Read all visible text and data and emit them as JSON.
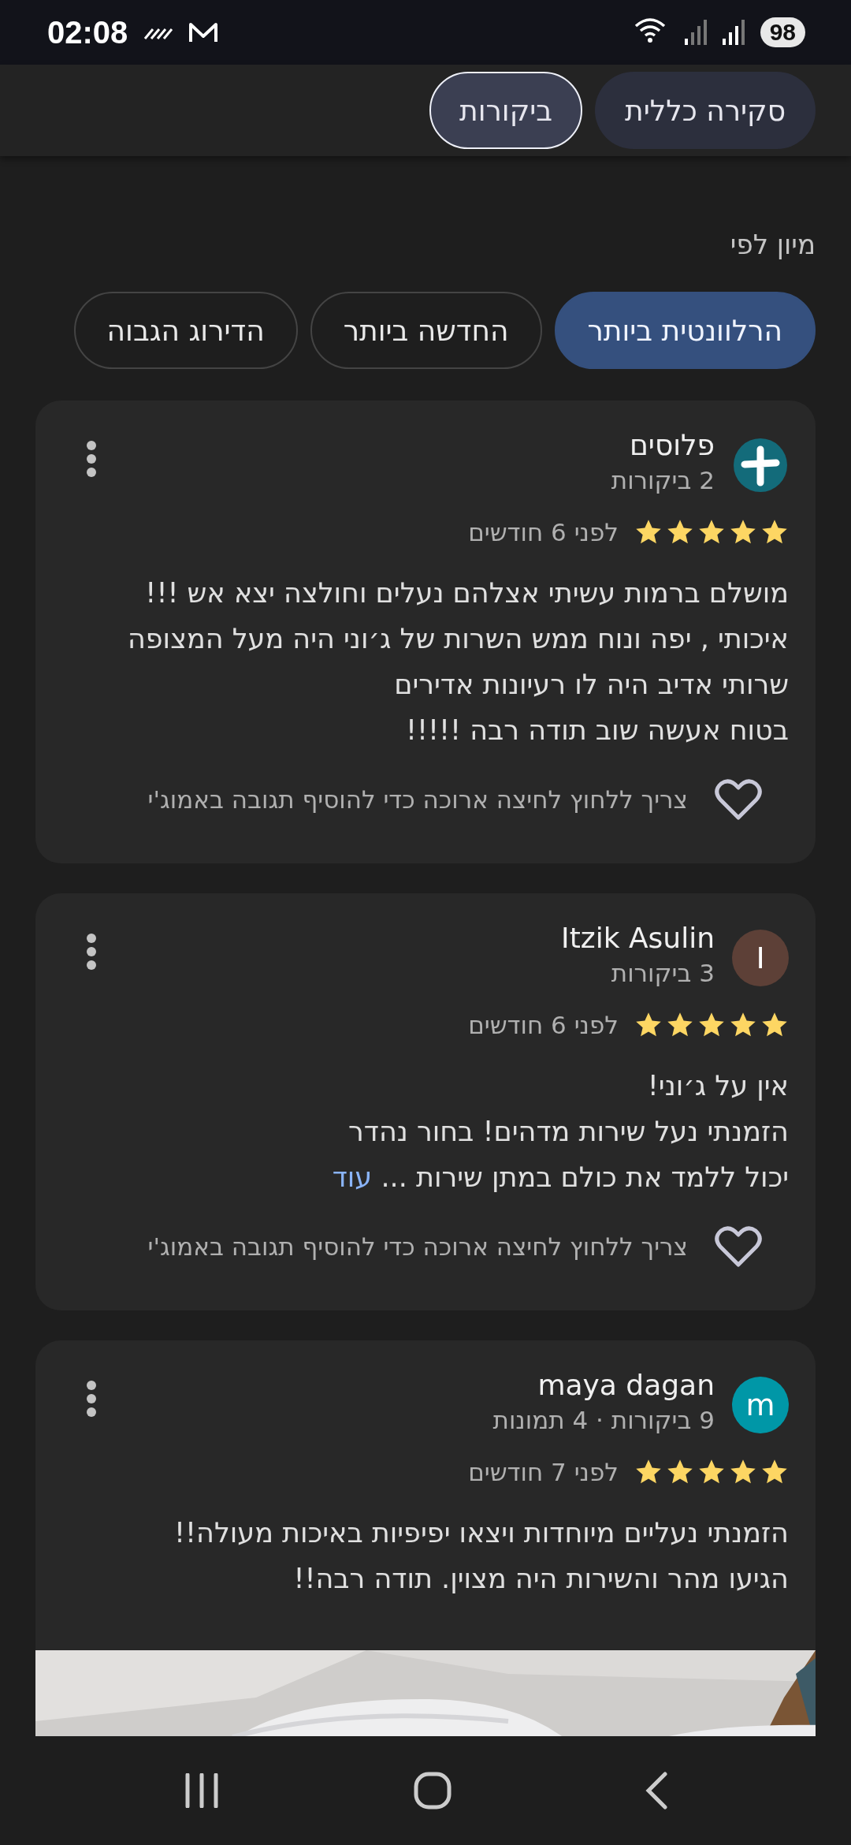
{
  "status_bar": {
    "time": "02:08",
    "battery": "98"
  },
  "tabs": [
    {
      "label": "סקירה כללית",
      "selected": false
    },
    {
      "label": "ביקורות",
      "selected": true
    }
  ],
  "sort": {
    "label": "מיון לפי",
    "chips": [
      {
        "label": "הרלוונטית ביותר",
        "selected": true
      },
      {
        "label": "החדשה ביותר",
        "selected": false
      },
      {
        "label": "הדירוג הגבוה",
        "selected": false
      }
    ]
  },
  "reviews": [
    {
      "author": "פלוסים",
      "kind": "plus",
      "color": "#136b7a",
      "meta": "2 ביקורות",
      "stars": 5,
      "time": "לפני 6 חודשים",
      "text": "מושלם ברמות עשיתי אצלהם נעלים וחולצה יצא אש !!!\nאיכותי , יפה ונוח ממש השרות של ג׳וני היה מעל המצופה\nשרותי אדיב היה לו רעיונות אדירים\nבטוח אעשה שוב תודה רבה !!!!!",
      "reply_hint": "צריך ללחוץ לחיצה ארוכה כדי להוסיף תגובה באמוג'י"
    },
    {
      "author": "Itzik Asulin",
      "kind": "letter",
      "avatar_letter": "I",
      "color": "#5d4037",
      "meta": "3 ביקורות",
      "stars": 5,
      "time": "לפני 6 חודשים",
      "text": "אין על ג׳וני!\nהזמנתי נעל שירות מדהים! בחור נהדר\nיכול ללמד את כולם במתן שירות ...",
      "more": "עוד",
      "reply_hint": "צריך ללחוץ לחיצה ארוכה כדי להוסיף תגובה באמוג'י"
    },
    {
      "author": "maya dagan",
      "kind": "letter",
      "avatar_letter": "m",
      "color": "#0097a7",
      "meta": "9 ביקורות · 4 תמונות",
      "stars": 5,
      "time": "לפני 7 חודשים",
      "text": "הזמנתי נעליים מיוחדות ויצאו יפיפיות באיכות מעולה!!\nהגיעו מהר והשירות היה מצוין. תודה רבה!!"
    }
  ]
}
